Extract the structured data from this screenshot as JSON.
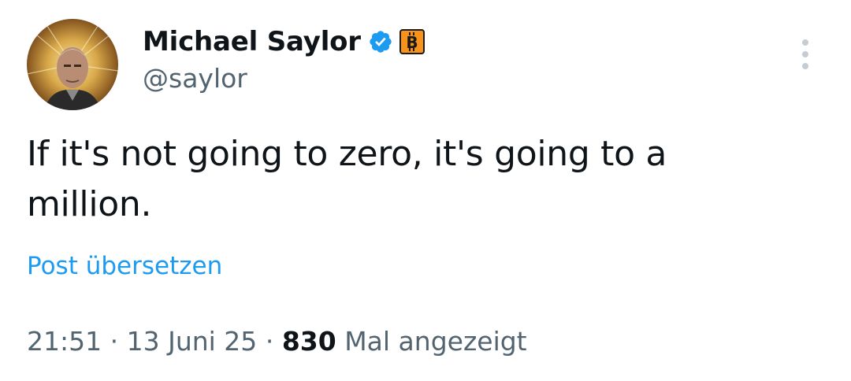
{
  "author": {
    "display_name": "Michael Saylor",
    "handle": "@saylor",
    "verified": true,
    "badge_icon": "bitcoin-badge-icon",
    "badge_color": "#f7931a",
    "verified_color": "#1d9bf0"
  },
  "tweet": {
    "text": "If it's not going to zero, it's going to a million.",
    "translate_label": "Post übersetzen"
  },
  "meta": {
    "time": "21:51",
    "date": "13 Juni 25",
    "separator": "·",
    "views_count": "830",
    "views_label": "Mal angezeigt"
  },
  "colors": {
    "link": "#1d9bf0",
    "secondary_text": "#536471",
    "primary_text": "#0f1419"
  }
}
